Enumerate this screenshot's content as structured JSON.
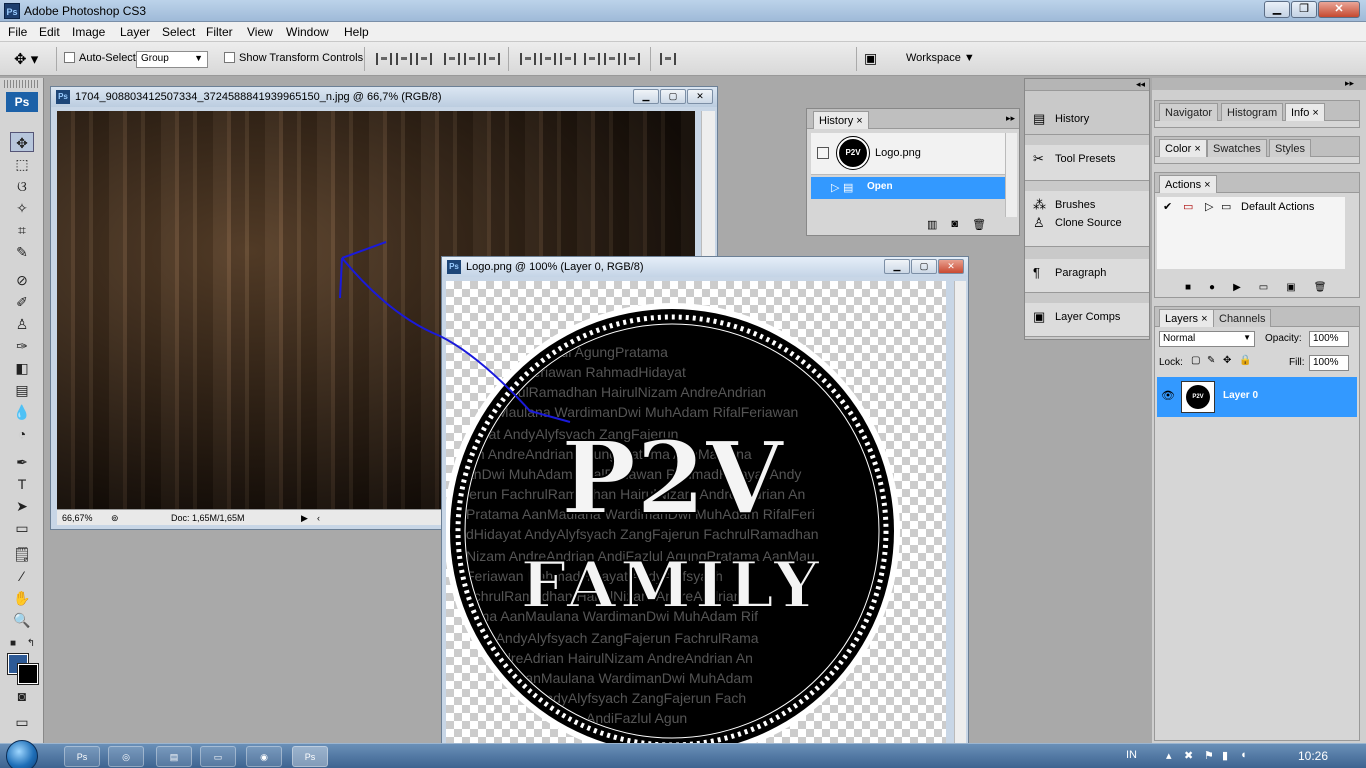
{
  "app": {
    "title": "Adobe Photoshop CS3",
    "logo": "Ps"
  },
  "menu": [
    "File",
    "Edit",
    "Image",
    "Layer",
    "Select",
    "Filter",
    "View",
    "Window",
    "Help"
  ],
  "options_bar": {
    "auto_select_label": "Auto-Select:",
    "auto_select_value": "Group",
    "show_transform_label": "Show Transform Controls",
    "workspace_label": "Workspace"
  },
  "toolbox": {
    "logo": "Ps",
    "tools": [
      "move-tool",
      "marquee-tool",
      "lasso-tool",
      "magic-wand-tool",
      "crop-tool",
      "slice-tool",
      "healing-tool",
      "brush-tool",
      "clone-stamp-tool",
      "history-brush-tool",
      "eraser-tool",
      "gradient-tool",
      "blur-tool",
      "dodge-tool",
      "pen-tool",
      "type-tool",
      "path-selection-tool",
      "shape-tool",
      "notes-tool",
      "eyedropper-tool",
      "hand-tool",
      "zoom-tool"
    ],
    "foreground_color": "#2d5a96",
    "background_color": "#000000"
  },
  "doc1": {
    "title": "1704_908803412507334_3724588841939965150_n.jpg @ 66,7% (RGB/8)",
    "zoom": "66,67%",
    "doc_size": "Doc: 1,65M/1,65M"
  },
  "doc2": {
    "title": "Logo.png @ 100% (Layer 0, RGB/8)"
  },
  "logo_art": {
    "main": "P2V",
    "sub": "FAMILY",
    "names": [
      "AndiFazlul AgungPratama",
      "RifalFeriawan RahmadHidayat",
      "FachrulRamadhan HairulNizam AndreAndrian",
      "AanMaulana WardimanDwi MuhAdam RifalFeriawan",
      "dayat AndyAlyfsyach ZangFajerun",
      "ian AndreAndrian AgungPratama AanMaulana",
      "anDwi MuhAdam RifalFeriawan RahmadHidayat Andy",
      "jerun FachrulRamadhan HairulNizam AndreAndrian An",
      "Pratama AanMaulana WardimanDwi MuhAdam RifalFeri",
      "dHidayat AndyAlyfsyach ZangFajerun FachrulRamadhan",
      "Nizam AndreAndrian AndiFazlul AgungPratama AanMau",
      "Feriawan RahmadHidayat AndyAlyfsyach",
      "achrulRamadhan HairulNizam AndreAndrian",
      "tama AanMaulana WardimanDwi MuhAdam Rif",
      "ayat AndyAlyfsyach ZangFajerun FachrulRama",
      "AndreAdrian HairulNizam AndreAndrian An",
      "AanMaulana WardimanDwi MuhAdam",
      "AndyAlyfsyach ZangFajerun Fach",
      "AndiFazlul Agun"
    ]
  },
  "history_panel": {
    "tab": "History",
    "snapshot_label": "Logo.png",
    "step_label": "Open"
  },
  "dock": {
    "history": "History",
    "tool_presets": "Tool Presets",
    "brushes": "Brushes",
    "clone_source": "Clone Source",
    "paragraph": "Paragraph",
    "layer_comps": "Layer Comps"
  },
  "nav_panel": {
    "tabs": [
      "Navigator",
      "Histogram",
      "Info"
    ]
  },
  "color_panel": {
    "tabs": [
      "Color",
      "Swatches",
      "Styles"
    ]
  },
  "actions_panel": {
    "tab": "Actions",
    "item": "Default Actions"
  },
  "layers_panel": {
    "tabs": [
      "Layers",
      "Channels"
    ],
    "blend_mode": "Normal",
    "opacity_label": "Opacity:",
    "opacity_value": "100%",
    "lock_label": "Lock:",
    "fill_label": "Fill:",
    "fill_value": "100%",
    "layer_name": "Layer 0"
  },
  "taskbar": {
    "language": "IN",
    "time": "10:26"
  },
  "colors": {
    "selection_blue": "#3399ff",
    "arrow_annotation": "#1a1adb"
  }
}
